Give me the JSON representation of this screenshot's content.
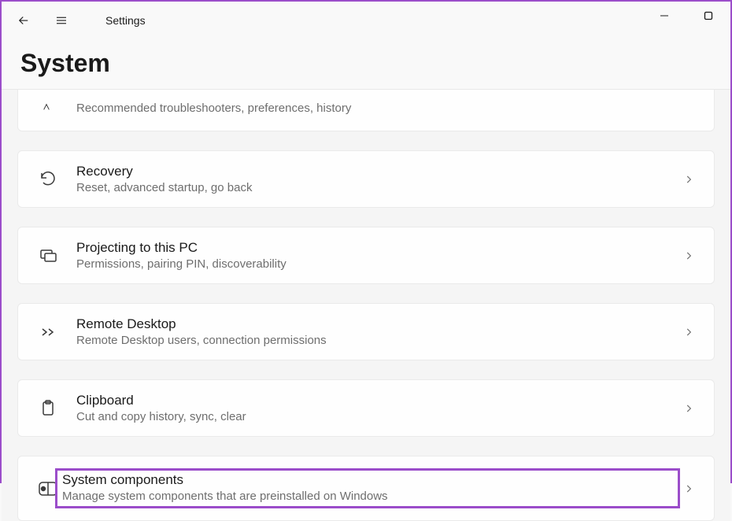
{
  "app": {
    "title": "Settings",
    "page_title": "System"
  },
  "items": [
    {
      "title": "",
      "subtitle": "Recommended troubleshooters, preferences, history",
      "icon": "wrench-icon",
      "partial": true,
      "chevron": false
    },
    {
      "title": "Recovery",
      "subtitle": "Reset, advanced startup, go back",
      "icon": "recovery-icon",
      "chevron": true
    },
    {
      "title": "Projecting to this PC",
      "subtitle": "Permissions, pairing PIN, discoverability",
      "icon": "projecting-icon",
      "chevron": true
    },
    {
      "title": "Remote Desktop",
      "subtitle": "Remote Desktop users, connection permissions",
      "icon": "remote-desktop-icon",
      "chevron": true
    },
    {
      "title": "Clipboard",
      "subtitle": "Cut and copy history, sync, clear",
      "icon": "clipboard-icon",
      "chevron": true
    },
    {
      "title": "System components",
      "subtitle": "Manage system components that are preinstalled on Windows",
      "icon": "system-components-icon",
      "chevron": true,
      "highlighted": true
    }
  ]
}
